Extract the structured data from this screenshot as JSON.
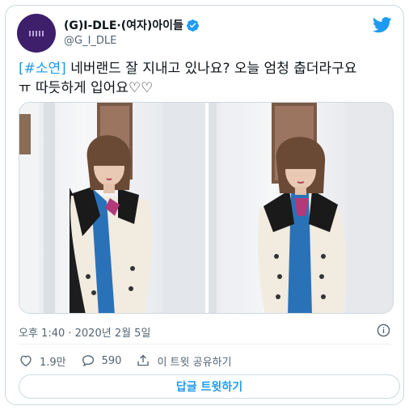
{
  "author": {
    "display_name": "(G)I-DLE·(여자)아이들",
    "handle": "@G_I_DLE",
    "verified": true,
    "avatar_color": "#3e1f6b"
  },
  "tweet": {
    "hashtag": "[#소연]",
    "line1_rest": " 네버랜드 잘 지내고 있나요? 오늘 엄청 춥더라구요",
    "line2": "ㅠ 따듯하게 입어요♡♡",
    "timestamp": "오후 1:40 · 2020년 2월 5일",
    "hashtag_color": "#1d9bf0"
  },
  "actions": {
    "likes": "1.9만",
    "replies": "590",
    "share": "이 트윗 공유하기"
  },
  "reply_button": "답글 트윗하기",
  "icons": [
    "verified-badge-icon",
    "twitter-bird-icon",
    "info-icon",
    "heart-icon",
    "reply-icon",
    "share-icon"
  ],
  "colors": {
    "brand": "#1d9bf0",
    "text": "#0f1419",
    "muted": "#536471",
    "border": "#cfd9de"
  }
}
